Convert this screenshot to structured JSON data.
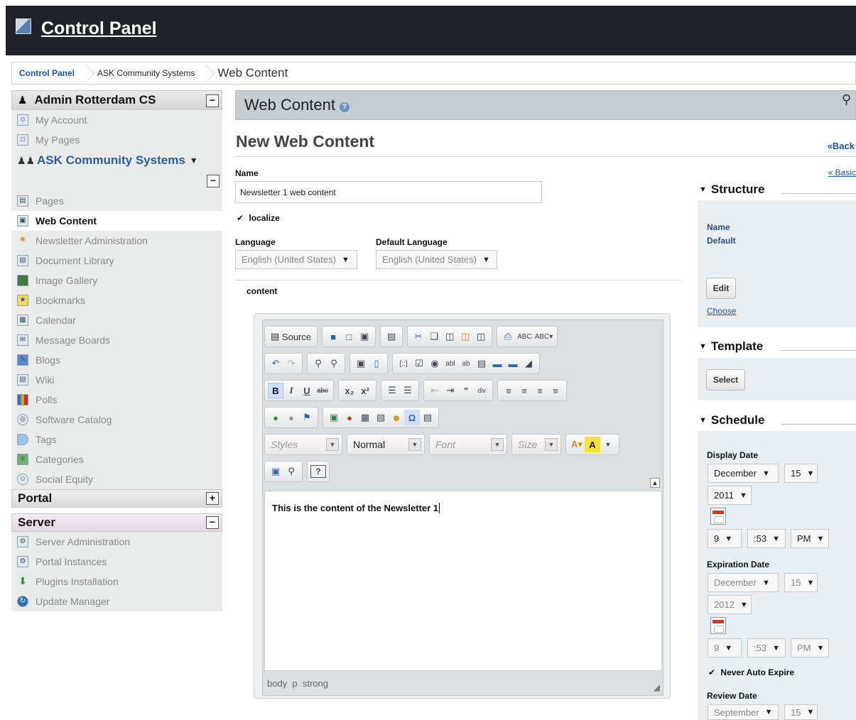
{
  "header": {
    "title": "Control Panel"
  },
  "breadcrumb": [
    "Control Panel",
    "ASK Community Systems",
    "Web Content"
  ],
  "sidebar": {
    "user_panel": {
      "title": "Admin Rotterdam CS",
      "items": [
        "My Account",
        "My Pages"
      ]
    },
    "community": {
      "title": "ASK Community Systems",
      "items": [
        "Pages",
        "Web Content",
        "Newsletter Administration",
        "Document Library",
        "Image Gallery",
        "Bookmarks",
        "Calendar",
        "Message Boards",
        "Blogs",
        "Wiki",
        "Polls",
        "Software Catalog",
        "Tags",
        "Categories",
        "Social Equity"
      ]
    },
    "portal": {
      "title": "Portal"
    },
    "server": {
      "title": "Server",
      "items": [
        "Server Administration",
        "Portal Instances",
        "Plugins Installation",
        "Update Manager"
      ]
    }
  },
  "main": {
    "bar_title": "Web Content",
    "page_title": "New Web Content",
    "back_label": "«Back",
    "basic_label": "« Basic",
    "name_label": "Name",
    "name_value": "Newsletter 1 web content",
    "localize_label": "localize",
    "language_label": "Language",
    "language_value": "English (United States)",
    "default_language_label": "Default Language",
    "default_language_value": "English (United States)",
    "content_label": "content"
  },
  "editor": {
    "source_label": "Source",
    "styles_label": "Styles",
    "format_label": "Normal",
    "font_label": "Font",
    "size_label": "Size",
    "body_text": "This is the content of the Newsletter 1",
    "status_path": "body  p  strong"
  },
  "structure": {
    "title": "Structure",
    "name_label": "Name",
    "name_value": "Default",
    "edit_label": "Edit",
    "choose_label": "Choose"
  },
  "template": {
    "title": "Template",
    "select_label": "Select"
  },
  "schedule": {
    "title": "Schedule",
    "display_date_label": "Display Date",
    "display_month": "December",
    "display_day": "15",
    "display_year": "2011",
    "display_hour": "9",
    "display_minute": ":53",
    "display_ampm": "PM",
    "expiration_date_label": "Expiration Date",
    "expiration_month": "December",
    "expiration_day": "15",
    "expiration_year": "2012",
    "expiration_hour": "9",
    "expiration_minute": ":53",
    "expiration_ampm": "PM",
    "never_expire_label": "Never Auto Expire",
    "review_date_label": "Review Date",
    "review_month": "September",
    "review_day": "15"
  },
  "colors": {
    "topbar": "#1f2327",
    "link": "#1d55a0",
    "mainbar": "#c8cdd3",
    "sidebar_bg": "#e9eaea"
  }
}
